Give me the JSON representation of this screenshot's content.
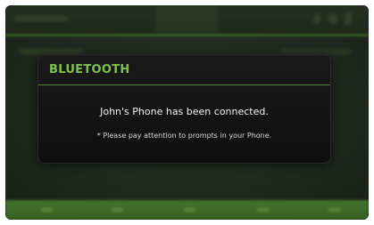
{
  "dialog": {
    "title": "BLUETOOTH",
    "message": "John's Phone has been connected.",
    "note": "* Please pay attention to prompts in your Phone."
  },
  "colors": {
    "accent": "#7cc34a",
    "dialog_background": "#141414",
    "bottom_bar": "#4a852b",
    "screen_background": "#243022"
  },
  "background_icons": [
    "status-icons",
    "volume-icon",
    "signal-icon",
    "bluetooth-icon"
  ]
}
